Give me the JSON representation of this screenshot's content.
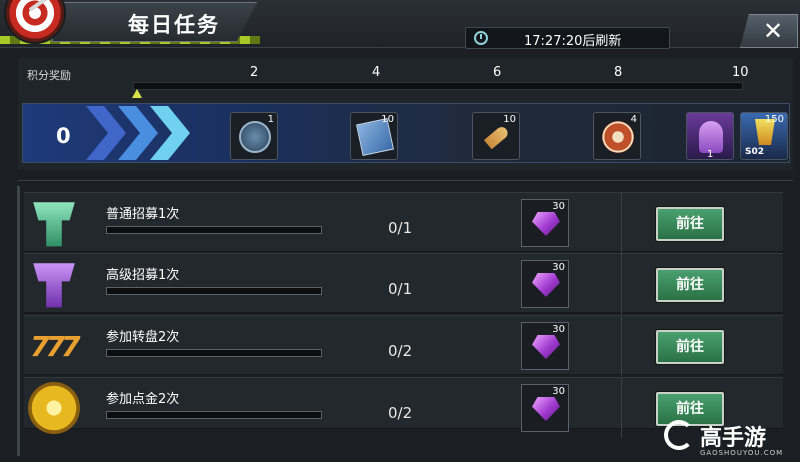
{
  "header": {
    "title": "每日任务",
    "refresh_timer": "17:27:20后刷新",
    "close_symbol": "✕"
  },
  "points": {
    "label": "积分奖励",
    "current": "0",
    "ticks": [
      "2",
      "4",
      "6",
      "8",
      "10"
    ],
    "progress_fraction": 0.0
  },
  "rewards": [
    {
      "icon": "coin-token-icon",
      "count": "1"
    },
    {
      "icon": "cinema-ticket-icon",
      "count": "10"
    },
    {
      "icon": "bullet-icon",
      "count": "10"
    },
    {
      "icon": "casino-chip-icon",
      "count": "4"
    },
    {
      "icon": "character-silhouette-icon",
      "count": "1"
    },
    {
      "icon": "drink-cocktail-icon",
      "count": "150",
      "tag": "S02"
    }
  ],
  "tasks": [
    {
      "name": "普通招募1次",
      "progress": "0/1",
      "reward_count": "30",
      "button": "前往",
      "icon": "green-recruit-icon"
    },
    {
      "name": "高级招募1次",
      "progress": "0/1",
      "reward_count": "30",
      "button": "前往",
      "icon": "purple-recruit-icon"
    },
    {
      "name": "参加转盘2次",
      "progress": "0/2",
      "reward_count": "30",
      "button": "前往",
      "icon": "slot-777-icon"
    },
    {
      "name": "参加点金2次",
      "progress": "0/2",
      "reward_count": "30",
      "button": "前往",
      "icon": "gold-diamond-coin-icon"
    }
  ],
  "watermark": {
    "text": "高手游",
    "sub": "GAOSHOUYOU.COM"
  },
  "colors": {
    "accent_green": "#a6c92a",
    "button_green": "#3a8a5a",
    "gem_purple": "#a03ad0"
  }
}
